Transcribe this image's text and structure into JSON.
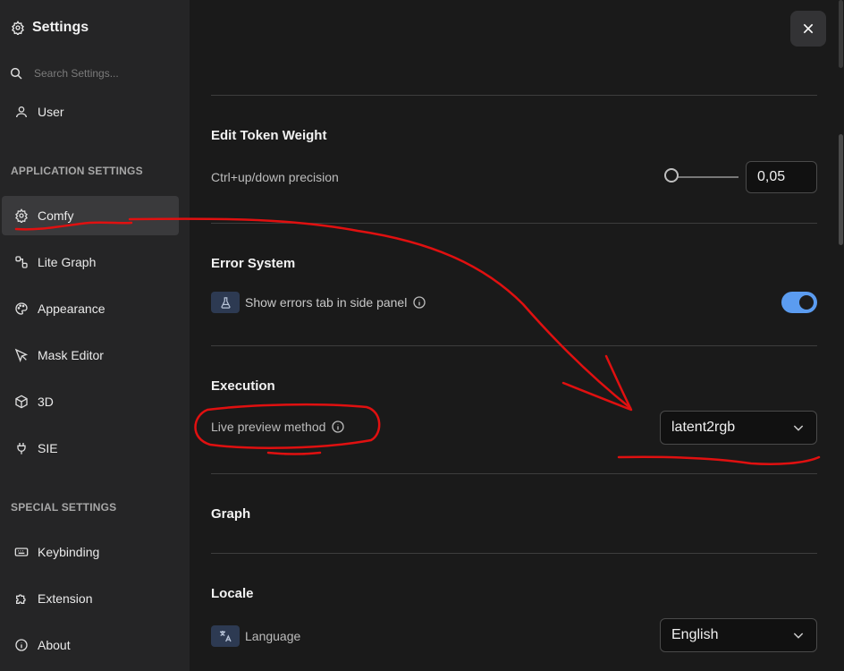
{
  "sidebar": {
    "title": "Settings",
    "search_placeholder": "Search Settings...",
    "user_label": "User",
    "app_section": "APPLICATION SETTINGS",
    "app_items": [
      "Comfy",
      "Lite Graph",
      "Appearance",
      "Mask Editor",
      "3D",
      "SIE"
    ],
    "special_section": "SPECIAL SETTINGS",
    "special_items": [
      "Keybinding",
      "Extension",
      "About"
    ],
    "active_item": "Comfy"
  },
  "groups": {
    "edit_token": {
      "title": "Edit Token Weight",
      "setting_label": "Ctrl+up/down precision",
      "value": "0,05"
    },
    "error_system": {
      "title": "Error System",
      "setting_label": "Show errors tab in side panel",
      "enabled": true
    },
    "execution": {
      "title": "Execution",
      "setting_label": "Live preview method",
      "value": "latent2rgb"
    },
    "graph": {
      "title": "Graph"
    },
    "locale": {
      "title": "Locale",
      "setting_label": "Language",
      "value": "English"
    }
  },
  "colors": {
    "sidebar_bg": "#252526",
    "main_bg": "#1a1a1a",
    "toggle_on": "#5b9cf0",
    "annotation": "#e01010"
  }
}
